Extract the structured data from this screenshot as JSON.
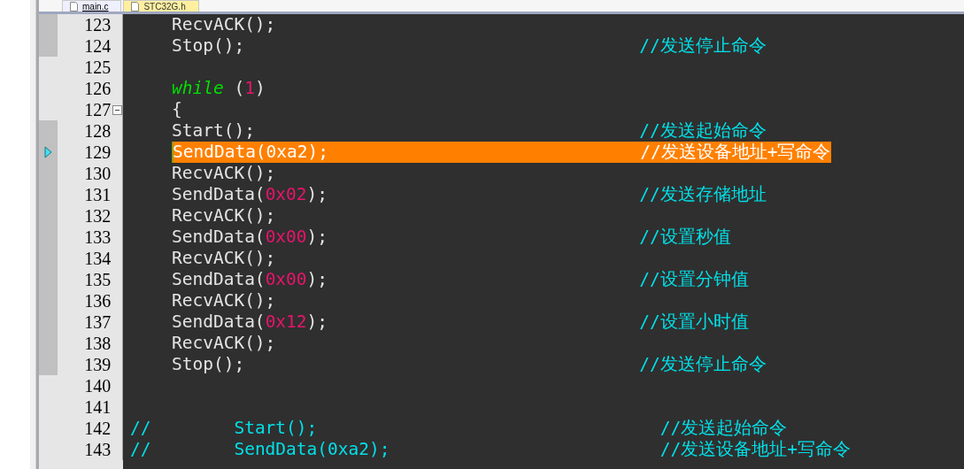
{
  "tabs": [
    {
      "label": "main.c",
      "selected": true
    },
    {
      "label": "STC32G.h",
      "selected": false
    }
  ],
  "lines": [
    {
      "number": "123",
      "bookmark": true,
      "fold": false,
      "current": false,
      "indented": true,
      "code": [
        {
          "text": "RecvACK();",
          "kind": "plain"
        }
      ]
    },
    {
      "number": "124",
      "bookmark": true,
      "fold": false,
      "current": false,
      "indented": true,
      "code": [
        {
          "text": "Stop();                                      ",
          "kind": "plain"
        },
        {
          "text": "//发送停止命令",
          "kind": "comment"
        }
      ]
    },
    {
      "number": "125",
      "bookmark": false,
      "fold": false,
      "current": false
    },
    {
      "number": "126",
      "bookmark": false,
      "fold": false,
      "current": false,
      "indented": true,
      "code": [
        {
          "text": "while",
          "kind": "keyword"
        },
        {
          "text": " (",
          "kind": "plain"
        },
        {
          "text": "1",
          "kind": "number"
        },
        {
          "text": ")",
          "kind": "plain"
        }
      ]
    },
    {
      "number": "127",
      "bookmark": false,
      "fold": true,
      "current": false,
      "indented": true,
      "code": [
        {
          "text": "{",
          "kind": "plain"
        }
      ]
    },
    {
      "number": "128",
      "bookmark": true,
      "fold": false,
      "current": false,
      "indented": true,
      "code": [
        {
          "text": "Start();                                     ",
          "kind": "plain"
        },
        {
          "text": "//发送起始命令",
          "kind": "comment"
        }
      ]
    },
    {
      "number": "129",
      "bookmark": true,
      "fold": false,
      "current": true,
      "indented": true,
      "code": [
        {
          "text": "SendData(0xa2);                              ",
          "kind": "plain"
        },
        {
          "text": "//发送设备地址+写命令",
          "kind": "comment"
        }
      ]
    },
    {
      "number": "130",
      "bookmark": true,
      "fold": false,
      "current": false,
      "indented": true,
      "code": [
        {
          "text": "RecvACK();",
          "kind": "plain"
        }
      ]
    },
    {
      "number": "131",
      "bookmark": true,
      "fold": false,
      "current": false,
      "indented": true,
      "code": [
        {
          "text": "SendData(",
          "kind": "plain"
        },
        {
          "text": "0x02",
          "kind": "number"
        },
        {
          "text": ");                              ",
          "kind": "plain"
        },
        {
          "text": "//发送存储地址",
          "kind": "comment"
        }
      ]
    },
    {
      "number": "132",
      "bookmark": true,
      "fold": false,
      "current": false,
      "indented": true,
      "code": [
        {
          "text": "RecvACK();",
          "kind": "plain"
        }
      ]
    },
    {
      "number": "133",
      "bookmark": true,
      "fold": false,
      "current": false,
      "indented": true,
      "code": [
        {
          "text": "SendData(",
          "kind": "plain"
        },
        {
          "text": "0x00",
          "kind": "number"
        },
        {
          "text": ");                              ",
          "kind": "plain"
        },
        {
          "text": "//设置秒值",
          "kind": "comment"
        }
      ]
    },
    {
      "number": "134",
      "bookmark": true,
      "fold": false,
      "current": false,
      "indented": true,
      "code": [
        {
          "text": "RecvACK();",
          "kind": "plain"
        }
      ]
    },
    {
      "number": "135",
      "bookmark": true,
      "fold": false,
      "current": false,
      "indented": true,
      "code": [
        {
          "text": "SendData(",
          "kind": "plain"
        },
        {
          "text": "0x00",
          "kind": "number"
        },
        {
          "text": ");                              ",
          "kind": "plain"
        },
        {
          "text": "//设置分钟值",
          "kind": "comment"
        }
      ]
    },
    {
      "number": "136",
      "bookmark": true,
      "fold": false,
      "current": false,
      "indented": true,
      "code": [
        {
          "text": "RecvACK();",
          "kind": "plain"
        }
      ]
    },
    {
      "number": "137",
      "bookmark": true,
      "fold": false,
      "current": false,
      "indented": true,
      "code": [
        {
          "text": "SendData(",
          "kind": "plain"
        },
        {
          "text": "0x12",
          "kind": "number"
        },
        {
          "text": ");                              ",
          "kind": "plain"
        },
        {
          "text": "//设置小时值",
          "kind": "comment"
        }
      ]
    },
    {
      "number": "138",
      "bookmark": true,
      "fold": false,
      "current": false,
      "indented": true,
      "code": [
        {
          "text": "RecvACK();",
          "kind": "plain"
        }
      ]
    },
    {
      "number": "139",
      "bookmark": true,
      "fold": false,
      "current": false,
      "indented": true,
      "code": [
        {
          "text": "Stop();                                      ",
          "kind": "plain"
        },
        {
          "text": "//发送停止命令",
          "kind": "comment"
        }
      ]
    },
    {
      "number": "140",
      "bookmark": false,
      "fold": false,
      "current": false
    },
    {
      "number": "141",
      "bookmark": false,
      "fold": false,
      "current": false
    },
    {
      "number": "142",
      "bookmark": false,
      "fold": false,
      "current": false,
      "indented": false,
      "code": [
        {
          "text": "//        Start();                                 //发送起始命令",
          "kind": "comment"
        }
      ]
    },
    {
      "number": "143",
      "bookmark": false,
      "fold": false,
      "current": false,
      "indented": false,
      "code": [
        {
          "text": "//        SendData(0xa2);                          //发送设备地址+写命令",
          "kind": "comment"
        }
      ]
    }
  ]
}
